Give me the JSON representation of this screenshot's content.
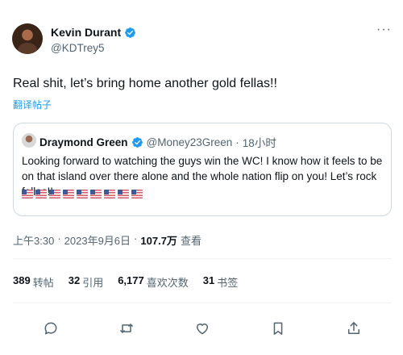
{
  "author": {
    "name": "Kevin Durant",
    "handle": "@KDTrey5",
    "verified": true
  },
  "more_icon": "ellipsis-icon",
  "tweet": {
    "text": "Real shit, let’s bring home another gold fellas!!",
    "translate_label": "翻译帖子"
  },
  "quote": {
    "name": "Draymond Green",
    "handle": "@Money23Green",
    "separator": "·",
    "time": "18小时",
    "text": "Looking forward to watching the guys win the WC! I know how it feels to be on that island over there alone and the whole nation flip on you! Let’s rock fellas!!",
    "flags": [
      "us-flag",
      "us-flag",
      "us-flag",
      "us-flag",
      "us-flag",
      "us-flag",
      "us-flag",
      "us-flag",
      "us-flag"
    ]
  },
  "meta": {
    "time": "上午3:30",
    "separator": "·",
    "date": "2023年9月6日",
    "separator2": "·",
    "views_count": "107.7万",
    "views_label": "查看"
  },
  "stats": [
    {
      "num": "389",
      "label": "转帖"
    },
    {
      "num": "32",
      "label": "引用"
    },
    {
      "num": "6,177",
      "label": "喜欢次数"
    },
    {
      "num": "31",
      "label": "书签"
    }
  ],
  "actions": [
    "reply-icon",
    "retweet-icon",
    "like-icon",
    "bookmark-icon",
    "share-icon"
  ],
  "colors": {
    "accent": "#1d9bf0",
    "text": "#0f1419",
    "muted": "#536471",
    "border": "#cfd9de"
  }
}
